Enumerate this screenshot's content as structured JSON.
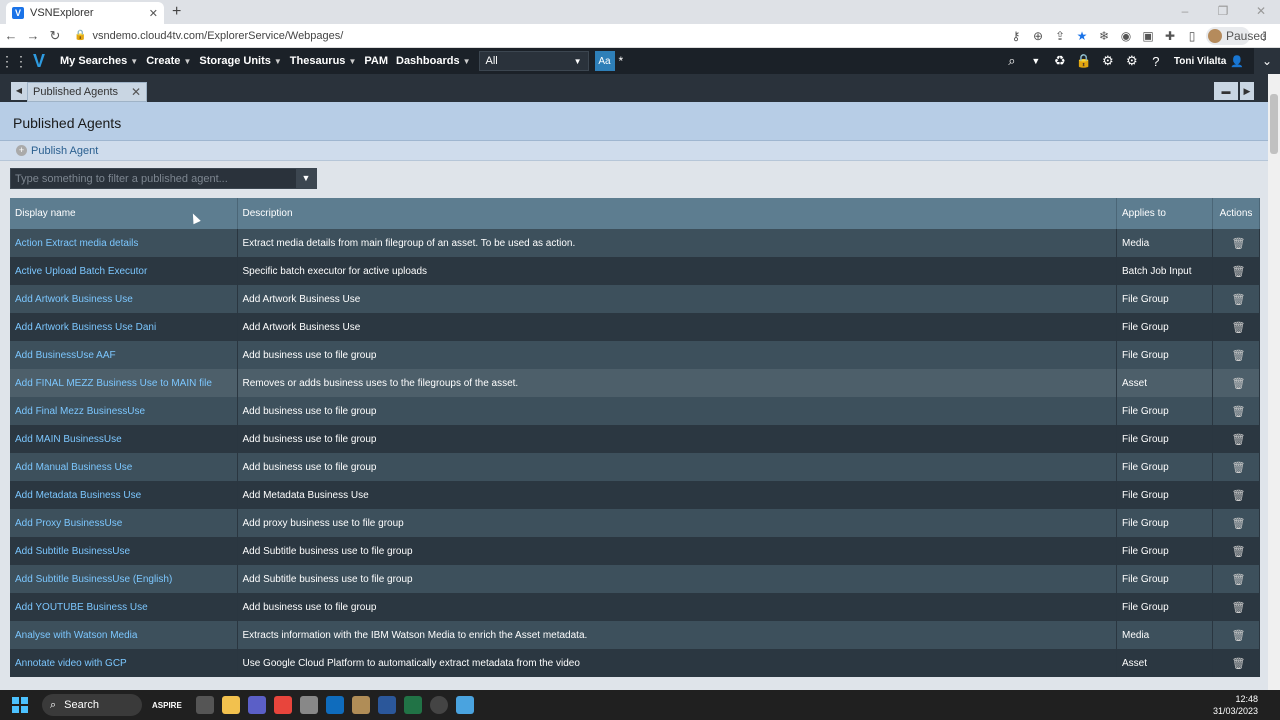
{
  "browser": {
    "tab_title": "VSNExplorer",
    "tab_favicon": "V",
    "url": "vsndemo.cloud4tv.com/ExplorerService/Webpages/",
    "profile_status": "Paused"
  },
  "header": {
    "menu": [
      {
        "label": "My Searches",
        "caret": true
      },
      {
        "label": "Create",
        "caret": true
      },
      {
        "label": "Storage Units",
        "caret": true
      },
      {
        "label": "Thesaurus",
        "caret": true
      },
      {
        "label": "PAM",
        "caret": false
      },
      {
        "label": "Dashboards",
        "caret": true
      }
    ],
    "search_scope": "All",
    "case_button": "Aa",
    "wildcard": "*",
    "user_name": "Toni Vilalta"
  },
  "page_tab": {
    "label": "Published Agents"
  },
  "page": {
    "title": "Published Agents",
    "publish_label": "Publish Agent",
    "filter_placeholder": "Type something to filter a published agent..."
  },
  "table": {
    "headers": {
      "name": "Display name",
      "description": "Description",
      "applies_to": "Applies to",
      "actions": "Actions"
    },
    "rows": [
      {
        "name": "Action Extract media details",
        "description": "Extract media details from main filegroup of an asset. To be used as action.",
        "applies_to": "Media"
      },
      {
        "name": "Active Upload Batch Executor",
        "description": "Specific batch executor for active uploads",
        "applies_to": "Batch Job Input"
      },
      {
        "name": "Add Artwork Business Use",
        "description": "Add Artwork Business Use",
        "applies_to": "File Group"
      },
      {
        "name": "Add Artwork Business Use Dani",
        "description": "Add Artwork Business Use",
        "applies_to": "File Group"
      },
      {
        "name": "Add BusinessUse AAF",
        "description": "Add business use to file group",
        "applies_to": "File Group"
      },
      {
        "name": "Add FINAL MEZZ Business Use to MAIN file",
        "description": "Removes or adds business uses to the filegroups of the asset.",
        "applies_to": "Asset"
      },
      {
        "name": "Add Final Mezz BusinessUse",
        "description": "Add business use to file group",
        "applies_to": "File Group"
      },
      {
        "name": "Add MAIN BusinessUse",
        "description": "Add business use to file group",
        "applies_to": "File Group"
      },
      {
        "name": "Add Manual Business Use",
        "description": "Add business use to file group",
        "applies_to": "File Group"
      },
      {
        "name": "Add Metadata Business Use",
        "description": "Add Metadata Business Use",
        "applies_to": "File Group"
      },
      {
        "name": "Add Proxy BusinessUse",
        "description": "Add proxy business use to file group",
        "applies_to": "File Group"
      },
      {
        "name": "Add Subtitle BusinessUse",
        "description": "Add Subtitle business use to file group",
        "applies_to": "File Group"
      },
      {
        "name": "Add Subtitle BusinessUse (English)",
        "description": "Add Subtitle business use to file group",
        "applies_to": "File Group"
      },
      {
        "name": "Add YOUTUBE Business Use",
        "description": "Add business use to file group",
        "applies_to": "File Group"
      },
      {
        "name": "Analyse with Watson Media",
        "description": "Extracts information with the IBM Watson Media to enrich the Asset metadata.",
        "applies_to": "Media"
      },
      {
        "name": "Annotate video with GCP",
        "description": "Use Google Cloud Platform to automatically extract metadata from the video",
        "applies_to": "Asset"
      }
    ]
  },
  "taskbar": {
    "search_label": "Search",
    "brand": "ASPIRE",
    "time": "12:48",
    "date": "31/03/2023"
  },
  "colors": {
    "accent": "#2e9be0",
    "link": "#7cc7ff",
    "header_bg": "#1b2128",
    "table_header": "#5d7d90"
  }
}
